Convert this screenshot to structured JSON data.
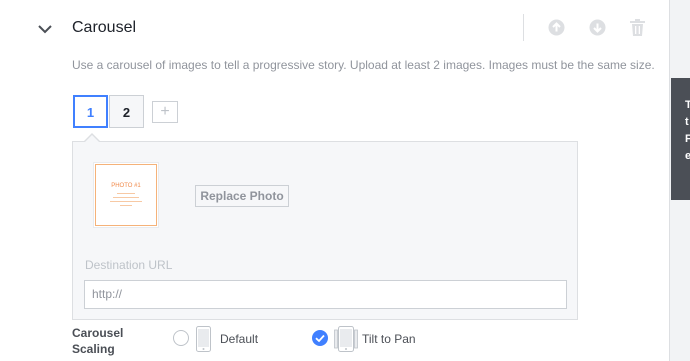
{
  "section": {
    "title": "Carousel",
    "description": "Use a carousel of images to tell a progressive story. Upload at least 2 images. Images must be the same size."
  },
  "icons": {
    "collapse": "chevron-down-icon",
    "move_up": "arrow-up-circle-icon",
    "move_down": "arrow-down-circle-icon",
    "delete": "trash-icon"
  },
  "tabs": [
    {
      "label": "1",
      "selected": true
    },
    {
      "label": "2",
      "selected": false
    }
  ],
  "add_tab_label": "+",
  "card": {
    "thumbnail_text": "PHOTO #1",
    "replace_button_label": "Replace Photo",
    "destination_label": "Destination URL",
    "destination_value": "http://"
  },
  "scaling": {
    "label": "Carousel Scaling",
    "options": [
      {
        "label": "Default",
        "selected": false
      },
      {
        "label": "Tilt to Pan",
        "selected": true
      }
    ]
  },
  "side_tooltip": {
    "lines": [
      "T",
      "t",
      "F",
      "e"
    ]
  },
  "colors": {
    "accent": "#4080ff",
    "muted_text": "#90949c",
    "border": "#dddfe2",
    "thumbnail_accent": "#f5b279"
  }
}
